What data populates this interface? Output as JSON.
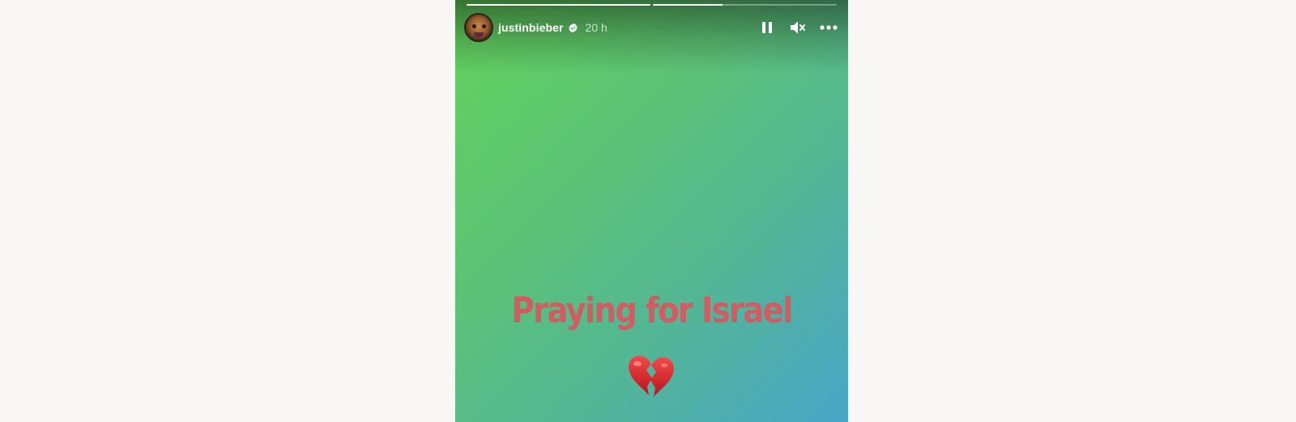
{
  "story": {
    "username": "justinbieber",
    "time_ago": "20 h",
    "verified": true,
    "progress": [
      1.0,
      0.38
    ],
    "caption": "Praying for Israel",
    "caption_emoji": "broken-heart",
    "background_colors": [
      "#62d35a",
      "#5cc277",
      "#52b598",
      "#4aa4c9"
    ],
    "caption_color": "#d35c62"
  },
  "controls": {
    "pause": "pause-icon",
    "mute": "muted-speaker-icon",
    "more": "more-options-icon"
  }
}
